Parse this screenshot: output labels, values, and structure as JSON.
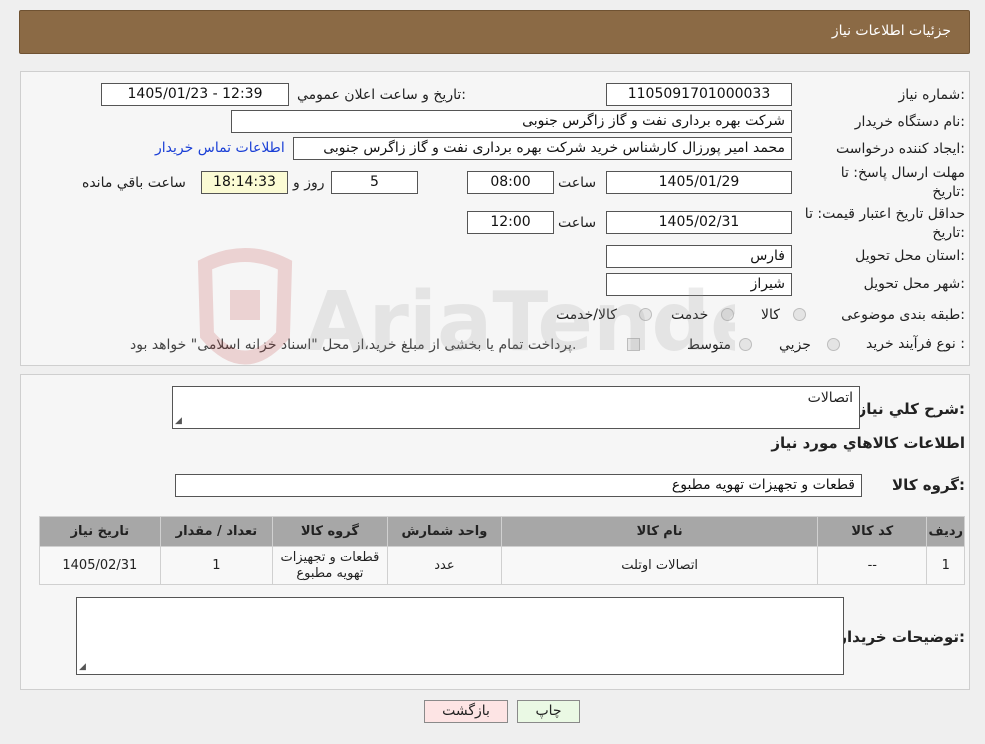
{
  "header": {
    "title": "جزئیات اطلاعات نیاز"
  },
  "fields": {
    "need_number_label": "شماره نیاز:",
    "need_number": "1105091701000033",
    "announce_label": "تاريخ و ساعت اعلان عمومي:",
    "announce_value": "1405/01/23 - 12:39",
    "buyer_org_label": "نام دستگاه خريدار:",
    "buyer_org": "شرکت بهره برداری نفت و گاز زاگرس جنوبی",
    "creator_label": "ايجاد کننده درخواست:",
    "creator": "محمد امیر پورزال کارشناس خرید شرکت بهره برداری نفت و گاز زاگرس جنوبی",
    "contact_link": "اطلاعات تماس خريدار",
    "deadline_label_1": "مهلت ارسال پاسخ: تا",
    "deadline_label_2": "تاريخ:",
    "deadline_date": "1405/01/29",
    "time_label": "ساعت",
    "deadline_time": "08:00",
    "days_value": "5",
    "days_label": "روز و",
    "remaining_time": "18:14:33",
    "remaining_label": "ساعت باقي مانده",
    "validity_label_1": "حداقل تاريخ اعتبار قيمت: تا",
    "validity_label_2": "تاريخ:",
    "validity_date": "1405/02/31",
    "validity_time": "12:00",
    "province_label": "استان محل تحويل:",
    "province": "فارس",
    "city_label": "شهر محل تحويل:",
    "city": "شيراز",
    "category_label": "طبقه بندی موضوعی:",
    "category_options": [
      "کالا",
      "خدمت",
      "کالا/خدمت"
    ],
    "process_label": "نوع فرآيند خريد :",
    "process_options": [
      "جزيي",
      "متوسط"
    ],
    "process_note": "پرداخت تمام يا بخشی از مبلغ خريد،از محل \"اسناد خزانه اسلامی\" خواهد بود."
  },
  "summary": {
    "desc_label": "شرح کلي نياز:",
    "desc_value": "اتصالات",
    "items_title": "اطلاعات کالاهاي مورد نياز",
    "group_label": "گروه کالا:",
    "group_value": "قطعات و تجهیزات تهویه مطبوع",
    "table_headers": [
      "رديف",
      "کد کالا",
      "نام کالا",
      "واحد شمارش",
      "گروه کالا",
      "تعداد / مقدار",
      "تاريخ نياز"
    ],
    "rows": [
      {
        "row": "1",
        "code": "--",
        "name": "اتصالات اوتلت",
        "unit": "عدد",
        "group_1": "قطعات و تجهیزات",
        "group_2": "تهویه مطبوع",
        "qty": "1",
        "date": "1405/02/31"
      }
    ],
    "buyer_notes_label": "توضيحات خريدار:"
  },
  "buttons": {
    "print": "چاپ",
    "back": "بازگشت"
  },
  "watermark_text": "AriaTender.neT",
  "colors": {
    "header_bg": "#8b6a45",
    "link": "#1a3fd6",
    "back_btn": "#fde4e4",
    "print_btn": "#eaf9e4"
  }
}
